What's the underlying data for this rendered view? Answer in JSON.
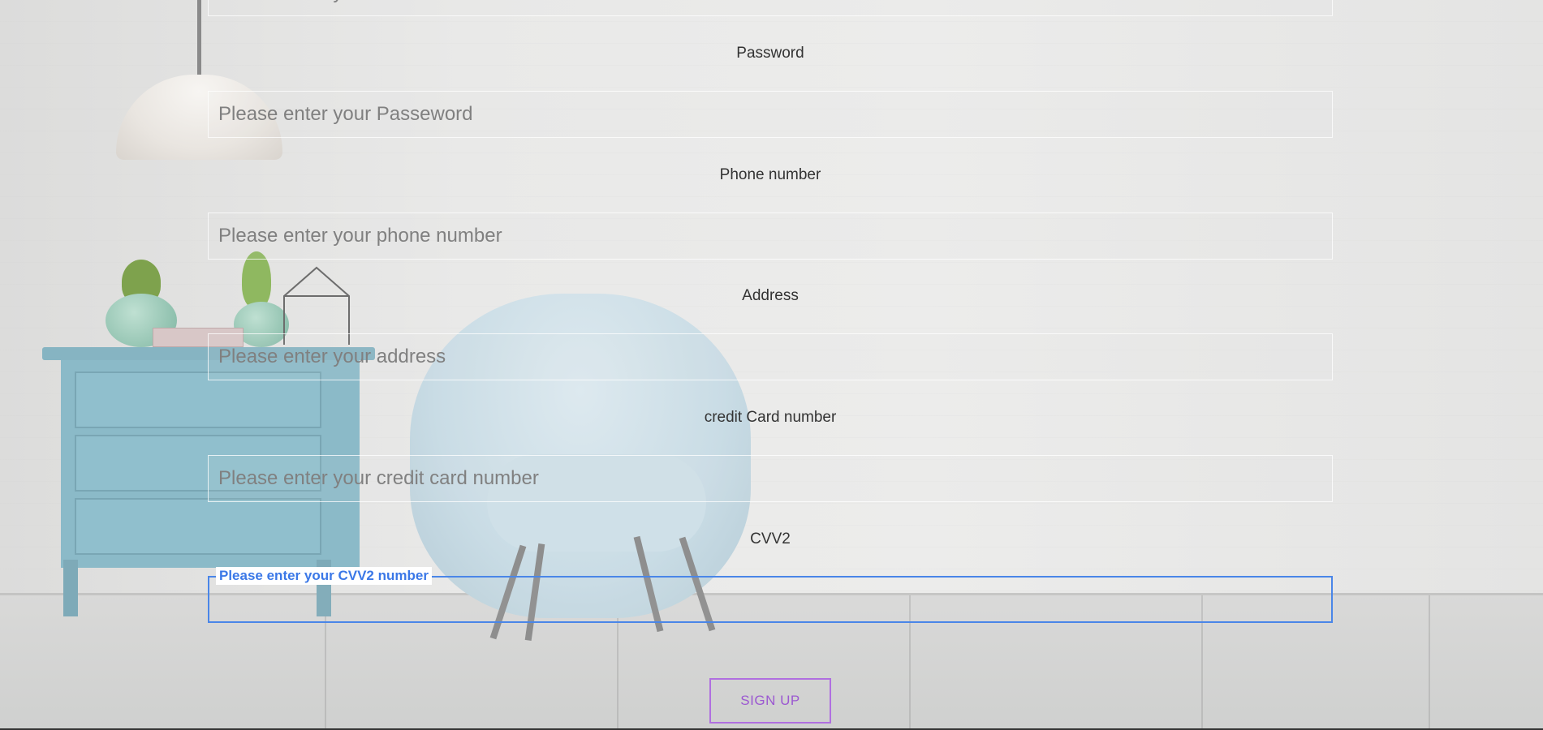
{
  "form": {
    "email": {
      "placeholder": "Please enter your E-mail"
    },
    "password": {
      "label": "Password",
      "placeholder": "Please enter your Passeword"
    },
    "phone": {
      "label": "Phone number",
      "placeholder": "Please enter your phone number"
    },
    "address": {
      "label": "Address",
      "placeholder": "Please enter your address"
    },
    "credit_card": {
      "label": "credit Card number",
      "placeholder": "Please enter your credit card number"
    },
    "cvv2": {
      "label": "CVV2",
      "floating_label": "Please enter your CVV2 number",
      "value": ""
    },
    "submit_label": "SIGN UP"
  },
  "colors": {
    "focus_border": "#4a86e8",
    "button_accent": "#b06fe0",
    "label_text": "#333333"
  }
}
